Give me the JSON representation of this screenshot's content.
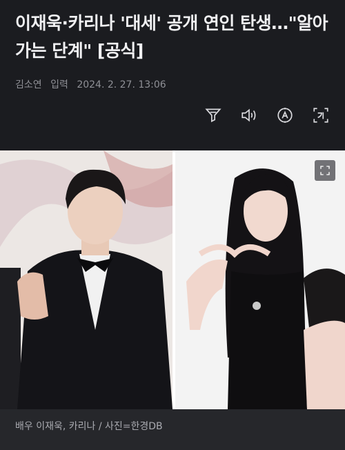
{
  "article": {
    "headline": "이재욱·카리나 '대세' 공개 연인 탄생…\"알아가는 단계\" [공식]",
    "reporter": "김소연",
    "published_label": "입력",
    "published_time": "2024. 2. 27. 13:06"
  },
  "toolbar": {
    "icons": [
      "filter-icon",
      "speaker-icon",
      "font-size-icon",
      "translate-icon"
    ]
  },
  "photo": {
    "expand_icon": "expand-icon"
  },
  "caption": {
    "text": "배우 이재욱, 카리나 / 사진=한경DB"
  }
}
